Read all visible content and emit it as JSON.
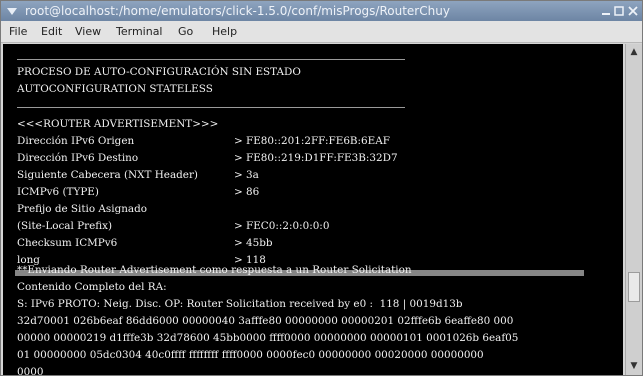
{
  "window": {
    "title": "root@localhost:/home/emulators/click-1.5.0/conf/misProgs/RouterChuy"
  },
  "menu": {
    "file": "File",
    "edit": "Edit",
    "view": "View",
    "terminal": "Terminal",
    "go": "Go",
    "help": "Help"
  },
  "terminal": {
    "heading1": "PROCESO DE AUTO-CONFIGURACIÓN SIN ESTADO",
    "heading2": "AUTOCONFIGURATION STATELESS",
    "section_title": "<<<ROUTER ADVERTISEMENT>>>",
    "fields": [
      {
        "label": "Dirección IPv6 Origen",
        "value": "> FE80::201:2FF:FE6B:6EAF"
      },
      {
        "label": "Dirección IPv6 Destino",
        "value": "> FE80::219:D1FF:FE3B:32D7"
      },
      {
        "label": "Siguiente Cabecera (NXT Header)",
        "value": "> 3a"
      },
      {
        "label": "ICMPv6 (TYPE)",
        "value": "> 86"
      },
      {
        "label": "Prefijo de Sitio Asignado",
        "value": ""
      },
      {
        "label": "(Site-Local Prefix)",
        "value": "> FEC0::2:0:0:0:0"
      },
      {
        "label": "Checksum ICMPv6",
        "value": "> 45bb"
      },
      {
        "label": "long",
        "value": "> 118"
      }
    ],
    "sending_msg": "**Enviando Router Advertisement como respuesta a un Router Solicitation",
    "content_label": "Contenido Completo del RA:",
    "dump": [
      "S: IPv6 PROTO: Neig. Disc. OP: Router Solicitation received by e0 :  118 | 0019d13b",
      "32d70001 026b6eaf 86dd6000 00000040 3afffe80 00000000 00000201 02fffe6b 6eaffe80 000",
      "00000 00000219 d1fffe3b 32d78600 45bb0000 ffff0000 00000000 00000101 0001026b 6eaf05",
      "01 00000000 05dc0304 40c0ffff ffffffff ffff0000 0000fec0 00000000 00020000 00000000",
      "0000"
    ]
  }
}
